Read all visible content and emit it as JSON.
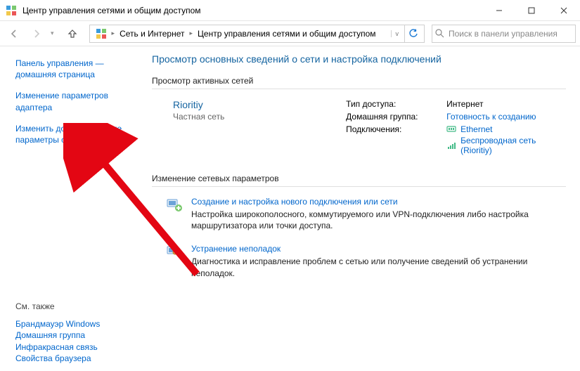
{
  "window": {
    "title": "Центр управления сетями и общим доступом",
    "min": "—",
    "max": "▢",
    "close": "✕"
  },
  "nav": {
    "back": "←",
    "forward": "→",
    "up": "↑",
    "refresh": "⟳"
  },
  "breadcrumb": {
    "root": "Сеть и Интернет",
    "current": "Центр управления сетями и общим доступом"
  },
  "search": {
    "placeholder": "Поиск в панели управления"
  },
  "sidebar": {
    "home": "Панель управления — домашняя страница",
    "adapter": "Изменение параметров адаптера",
    "advanced": "Изменить дополнительные параметры общего доступа",
    "see_also_label": "См. также",
    "see_also": {
      "firewall": "Брандмауэр Windows",
      "homegroup": "Домашняя группа",
      "infrared": "Инфракрасная связь",
      "browser": "Свойства браузера"
    }
  },
  "main": {
    "heading": "Просмотр основных сведений о сети и настройка подключений",
    "active_networks_label": "Просмотр активных сетей",
    "network": {
      "name": "Rioritiy",
      "type": "Частная сеть",
      "access_label": "Тип доступа:",
      "access_value": "Интернет",
      "homegroup_label": "Домашняя группа:",
      "homegroup_value": "Готовность к созданию",
      "connections_label": "Подключения:",
      "conn_ethernet": "Ethernet",
      "conn_wifi": "Беспроводная сеть (Rioritiy)"
    },
    "change_settings_label": "Изменение сетевых параметров",
    "action_new": {
      "title": "Создание и настройка нового подключения или сети",
      "desc": "Настройка широкополосного, коммутируемого или VPN-подключения либо настройка маршрутизатора или точки доступа."
    },
    "action_troubleshoot": {
      "title": "Устранение неполадок",
      "desc": "Диагностика и исправление проблем с сетью или получение сведений об устранении неполадок."
    }
  }
}
